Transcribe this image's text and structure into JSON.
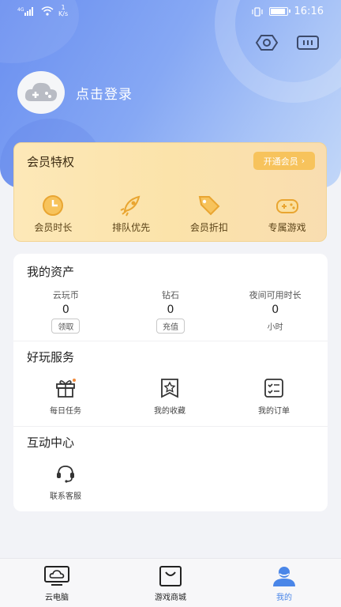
{
  "status_bar": {
    "net_speed_value": "1",
    "net_speed_unit": "K/s",
    "time": "16:16"
  },
  "header": {
    "login_text": "点击登录",
    "icons": [
      "eye-icon",
      "game-controller-icon"
    ]
  },
  "vip": {
    "title": "会员特权",
    "button_label": "开通会员",
    "items": [
      {
        "label": "会员时长",
        "icon": "clock-icon"
      },
      {
        "label": "排队优先",
        "icon": "rocket-icon"
      },
      {
        "label": "会员折扣",
        "icon": "tag-icon"
      },
      {
        "label": "专属游戏",
        "icon": "gamepad-icon"
      }
    ]
  },
  "assets": {
    "title": "我的资产",
    "items": [
      {
        "label": "云玩币",
        "value": "0",
        "action": "领取"
      },
      {
        "label": "钻石",
        "value": "0",
        "action": "充值"
      },
      {
        "label": "夜间可用时长",
        "value": "0",
        "unit": "小时"
      }
    ]
  },
  "services": {
    "title": "好玩服务",
    "items": [
      {
        "label": "每日任务",
        "icon": "gift-icon"
      },
      {
        "label": "我的收藏",
        "icon": "star-bookmark-icon"
      },
      {
        "label": "我的订单",
        "icon": "order-list-icon"
      }
    ]
  },
  "interaction": {
    "title": "互动中心",
    "items": [
      {
        "label": "联系客服",
        "icon": "headset-icon"
      }
    ]
  },
  "bottom_nav": {
    "items": [
      {
        "label": "云电脑",
        "icon": "cloud-monitor-icon"
      },
      {
        "label": "游戏商城",
        "icon": "shop-bag-icon"
      },
      {
        "label": "我的",
        "icon": "user-icon",
        "active": true
      }
    ]
  },
  "colors": {
    "accent": "#4a86e8",
    "vip_gold": "#f7c35c",
    "vip_icon": "#e9a531"
  }
}
